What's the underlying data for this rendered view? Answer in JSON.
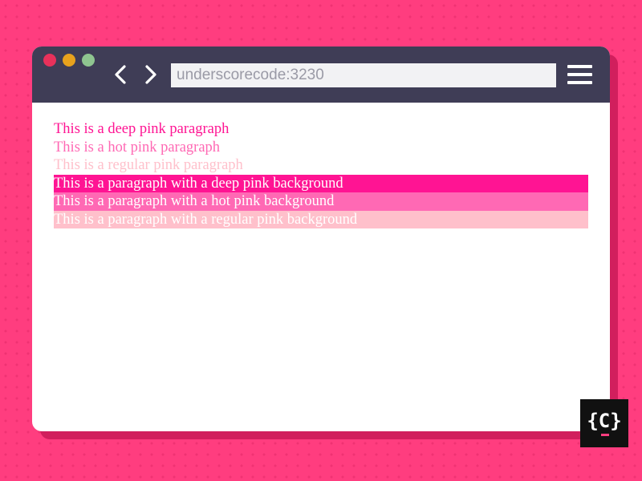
{
  "browser": {
    "address": "underscorecode:3230"
  },
  "paragraphs": {
    "deep_text": "This is a deep pink paragraph",
    "hot_text": "This is a hot pink paragraph",
    "pink_text": "This is a regular pink paragraph",
    "deep_bg": "This is a paragraph with a deep pink background",
    "hot_bg": "This is a paragraph with a hot pink background",
    "pink_bg": "This is a paragraph with a regular pink background"
  },
  "colors": {
    "page_background": "#ff3d7f",
    "titlebar": "#3f3d56",
    "deep_pink": "#ff1493",
    "hot_pink": "#ff69b4",
    "pink": "#ffc0cb"
  },
  "icons": {
    "back": "chevron-left-icon",
    "forward": "chevron-right-icon",
    "menu": "hamburger-menu-icon"
  },
  "logo": {
    "text": "{C}"
  }
}
